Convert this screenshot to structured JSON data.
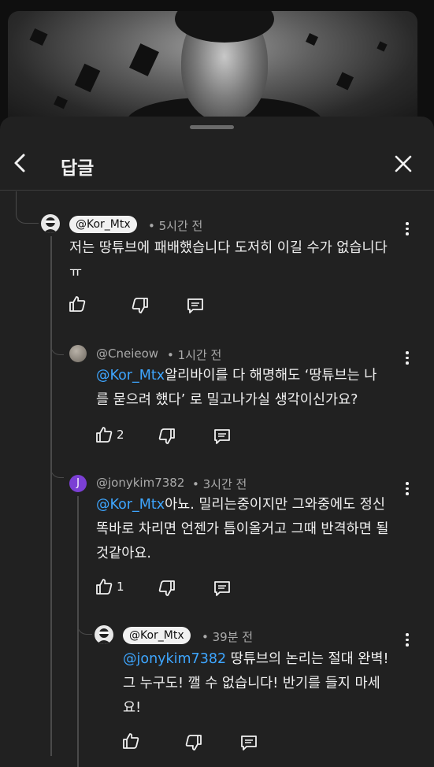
{
  "header": {
    "title": "답글"
  },
  "comments": [
    {
      "handle": "@Kor_Mtx",
      "time": "• 5시간 전",
      "text_line1": "저는 땅튜브에 패배했습니다 도저히 이길 수가 없습니다",
      "text_line2": "ㅠ",
      "likes": ""
    },
    {
      "handle": "@Cneieow",
      "time": "• 1시간 전",
      "mention": "@Kor_Mtx",
      "text_line1_rest": "알리바이를 다 해명해도 ‘땅튜브는 나",
      "text_line2": "를 묻으려 했다’ 로 밀고나가실 생각이신가요?",
      "likes": "2"
    },
    {
      "handle": "@jonykim7382",
      "avatar_letter": "J",
      "time": "• 3시간 전",
      "mention": "@Kor_Mtx",
      "text_line1_rest": "아뇨. 밀리는중이지만 그와중에도 정신",
      "text_line2": "똑바로 차리면 언젠가 틈이올거고 그때 반격하면 될",
      "text_line3": "것같아요.",
      "likes": "1"
    },
    {
      "handle": "@Kor_Mtx",
      "time": "• 39분 전",
      "mention": "@jonykim7382",
      "text_line1_rest": " 땅튜브의 논리는 절대 완벽!",
      "text_line2": "그 누구도! 깰 수 없습니다! 반기를 들지 마세",
      "text_line3": "요!",
      "likes": ""
    }
  ],
  "colors": {
    "background": "#0f0f0f",
    "sheet": "#212121",
    "mention": "#3ea6ff",
    "avatar_j": "#7b3fd4"
  },
  "icons": [
    "back-arrow-icon",
    "close-icon",
    "like-icon",
    "dislike-icon",
    "reply-icon",
    "more-vert-icon"
  ]
}
